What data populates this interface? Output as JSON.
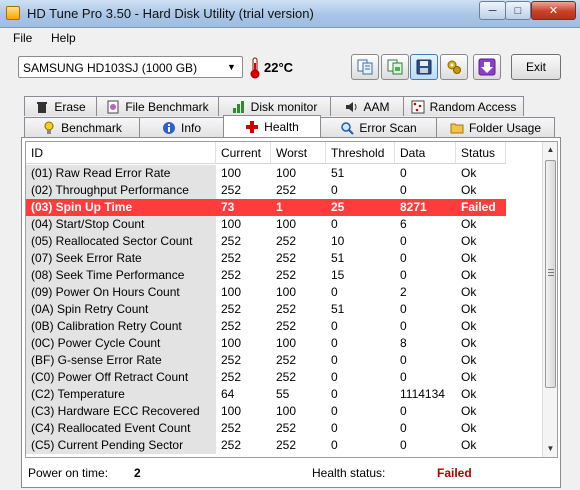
{
  "window": {
    "title": "HD Tune Pro 3.50 - Hard Disk Utility (trial version)"
  },
  "menu": [
    "File",
    "Help"
  ],
  "toolbar": {
    "drive": "SAMSUNG HD103SJ (1000 GB)",
    "temperature": "22°C",
    "exit_label": "Exit"
  },
  "tabs_top": [
    {
      "label": "Erase",
      "icon": "trash-icon"
    },
    {
      "label": "File Benchmark",
      "icon": "file-benchmark-icon"
    },
    {
      "label": "Disk monitor",
      "icon": "disk-monitor-icon"
    },
    {
      "label": "AAM",
      "icon": "speaker-icon"
    },
    {
      "label": "Random Access",
      "icon": "random-access-icon"
    }
  ],
  "tabs_bottom": [
    {
      "label": "Benchmark",
      "icon": "lightbulb-icon"
    },
    {
      "label": "Info",
      "icon": "info-icon"
    },
    {
      "label": "Health",
      "icon": "health-cross-icon"
    },
    {
      "label": "Error Scan",
      "icon": "magnifier-icon"
    },
    {
      "label": "Folder Usage",
      "icon": "folder-icon"
    }
  ],
  "columns": [
    "ID",
    "Current",
    "Worst",
    "Threshold",
    "Data",
    "Status"
  ],
  "rows": [
    [
      "(01) Raw Read Error Rate",
      "100",
      "100",
      "51",
      "0",
      "Ok"
    ],
    [
      "(02) Throughput Performance",
      "252",
      "252",
      "0",
      "0",
      "Ok"
    ],
    [
      "(03) Spin Up Time",
      "73",
      "1",
      "25",
      "8271",
      "Failed"
    ],
    [
      "(04) Start/Stop Count",
      "100",
      "100",
      "0",
      "6",
      "Ok"
    ],
    [
      "(05) Reallocated Sector Count",
      "252",
      "252",
      "10",
      "0",
      "Ok"
    ],
    [
      "(07) Seek Error Rate",
      "252",
      "252",
      "51",
      "0",
      "Ok"
    ],
    [
      "(08) Seek Time Performance",
      "252",
      "252",
      "15",
      "0",
      "Ok"
    ],
    [
      "(09) Power On Hours Count",
      "100",
      "100",
      "0",
      "2",
      "Ok"
    ],
    [
      "(0A) Spin Retry Count",
      "252",
      "252",
      "51",
      "0",
      "Ok"
    ],
    [
      "(0B) Calibration Retry Count",
      "252",
      "252",
      "0",
      "0",
      "Ok"
    ],
    [
      "(0C) Power Cycle Count",
      "100",
      "100",
      "0",
      "8",
      "Ok"
    ],
    [
      "(BF) G-sense Error Rate",
      "252",
      "252",
      "0",
      "0",
      "Ok"
    ],
    [
      "(C0) Power Off Retract Count",
      "252",
      "252",
      "0",
      "0",
      "Ok"
    ],
    [
      "(C2) Temperature",
      "64",
      "55",
      "0",
      "1114134",
      "Ok"
    ],
    [
      "(C3) Hardware ECC Recovered",
      "100",
      "100",
      "0",
      "0",
      "Ok"
    ],
    [
      "(C4) Reallocated Event Count",
      "252",
      "252",
      "0",
      "0",
      "Ok"
    ],
    [
      "(C5) Current Pending Sector",
      "252",
      "252",
      "0",
      "0",
      "Ok"
    ]
  ],
  "failed_row_index": 2,
  "footer": {
    "power_on_label": "Power on time:",
    "power_on_value": "2",
    "health_label": "Health status:",
    "health_value": "Failed"
  },
  "colors": {
    "failed_row": "#ff3c3c",
    "failed_text": "#b00000",
    "title_bar": "#a9c6e7"
  }
}
